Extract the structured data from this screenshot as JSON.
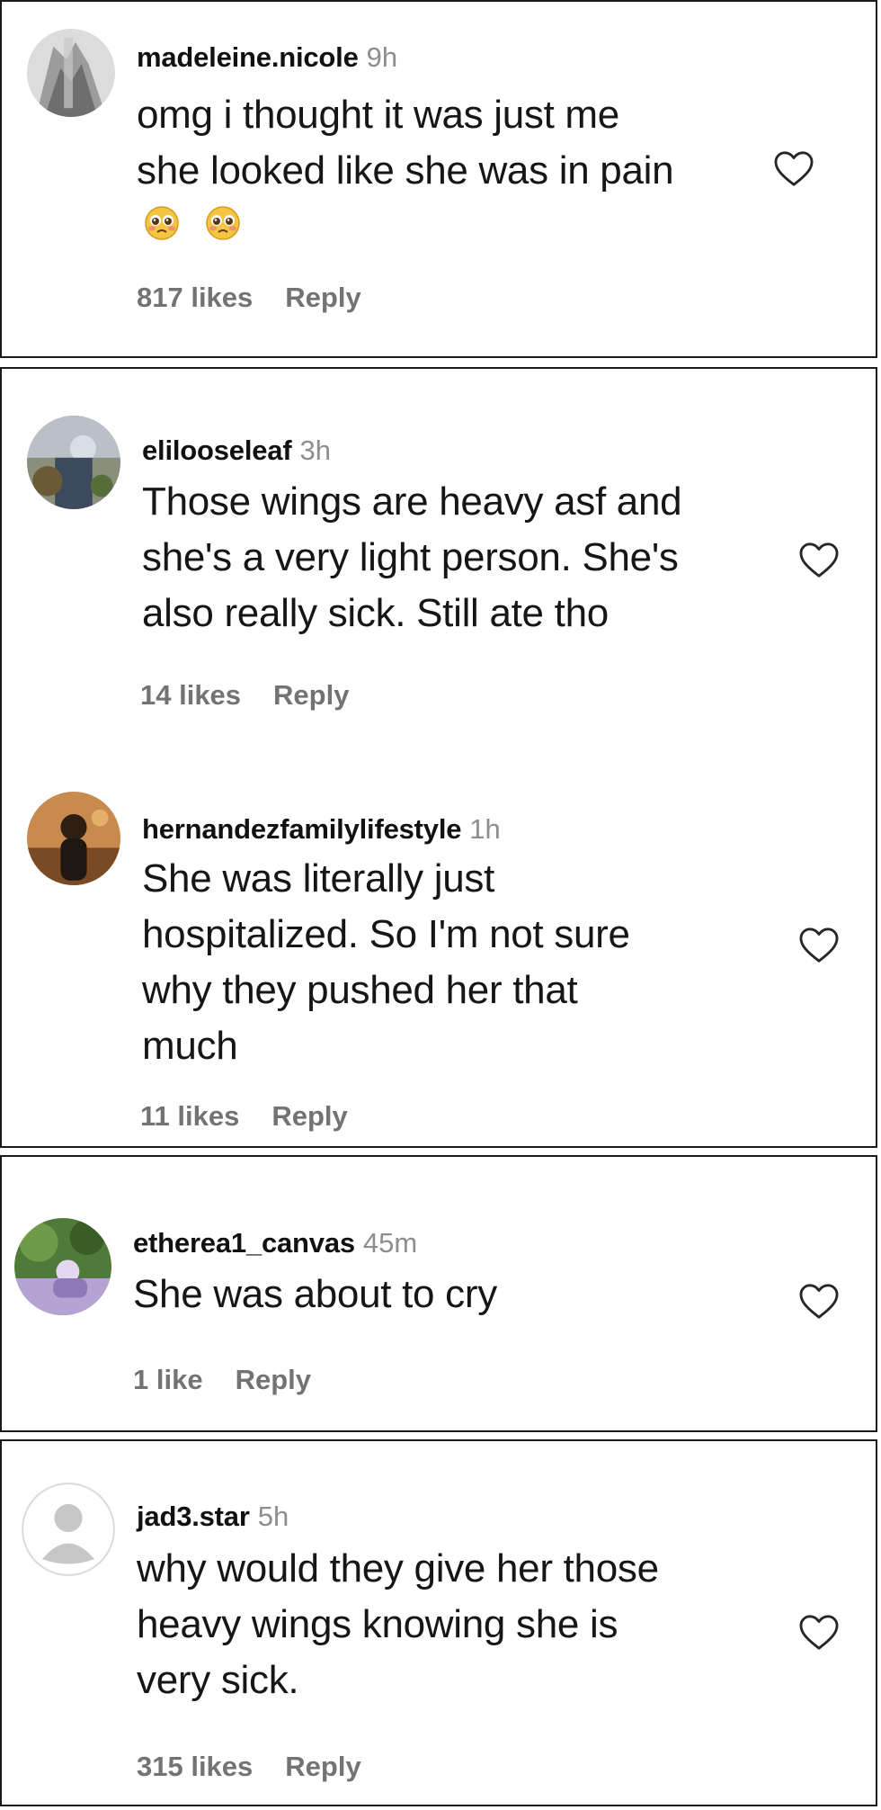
{
  "comments": [
    {
      "username": "madeleine.nicole",
      "time": "9h",
      "lines": [
        "omg i thought it was just me",
        "she looked like she was in pain"
      ],
      "likes": "817 likes",
      "reply": "Reply",
      "emoji": [
        "pleading-face-emoji",
        "pleading-face-emoji"
      ]
    },
    {
      "username": "elilooseleaf",
      "time": "3h",
      "lines": [
        "Those wings are heavy asf and",
        "she's a very light person. She's",
        "also really sick. Still ate tho"
      ],
      "likes": "14 likes",
      "reply": "Reply"
    },
    {
      "username": "hernandezfamilylifestyle",
      "time": "1h",
      "lines": [
        "She was literally just",
        "hospitalized. So I'm not sure",
        "why they pushed her that",
        "much"
      ],
      "likes": "11 likes",
      "reply": "Reply"
    },
    {
      "username": "etherea1_canvas",
      "time": "45m",
      "lines": [
        "She was about to cry"
      ],
      "likes": "1 like",
      "reply": "Reply"
    },
    {
      "username": "jad3.star",
      "time": "5h",
      "lines": [
        "why would they give her those",
        "heavy wings knowing she is",
        "very sick."
      ],
      "likes": "315 likes",
      "reply": "Reply"
    }
  ],
  "colors": {
    "text": "#161616",
    "muted": "#8e8e8e",
    "action": "#737373",
    "border": "#1a1a1a",
    "heart_outline": "#262626"
  },
  "icons": {
    "like": "heart-outline-icon",
    "default_avatar": "default-user-avatar-icon"
  }
}
